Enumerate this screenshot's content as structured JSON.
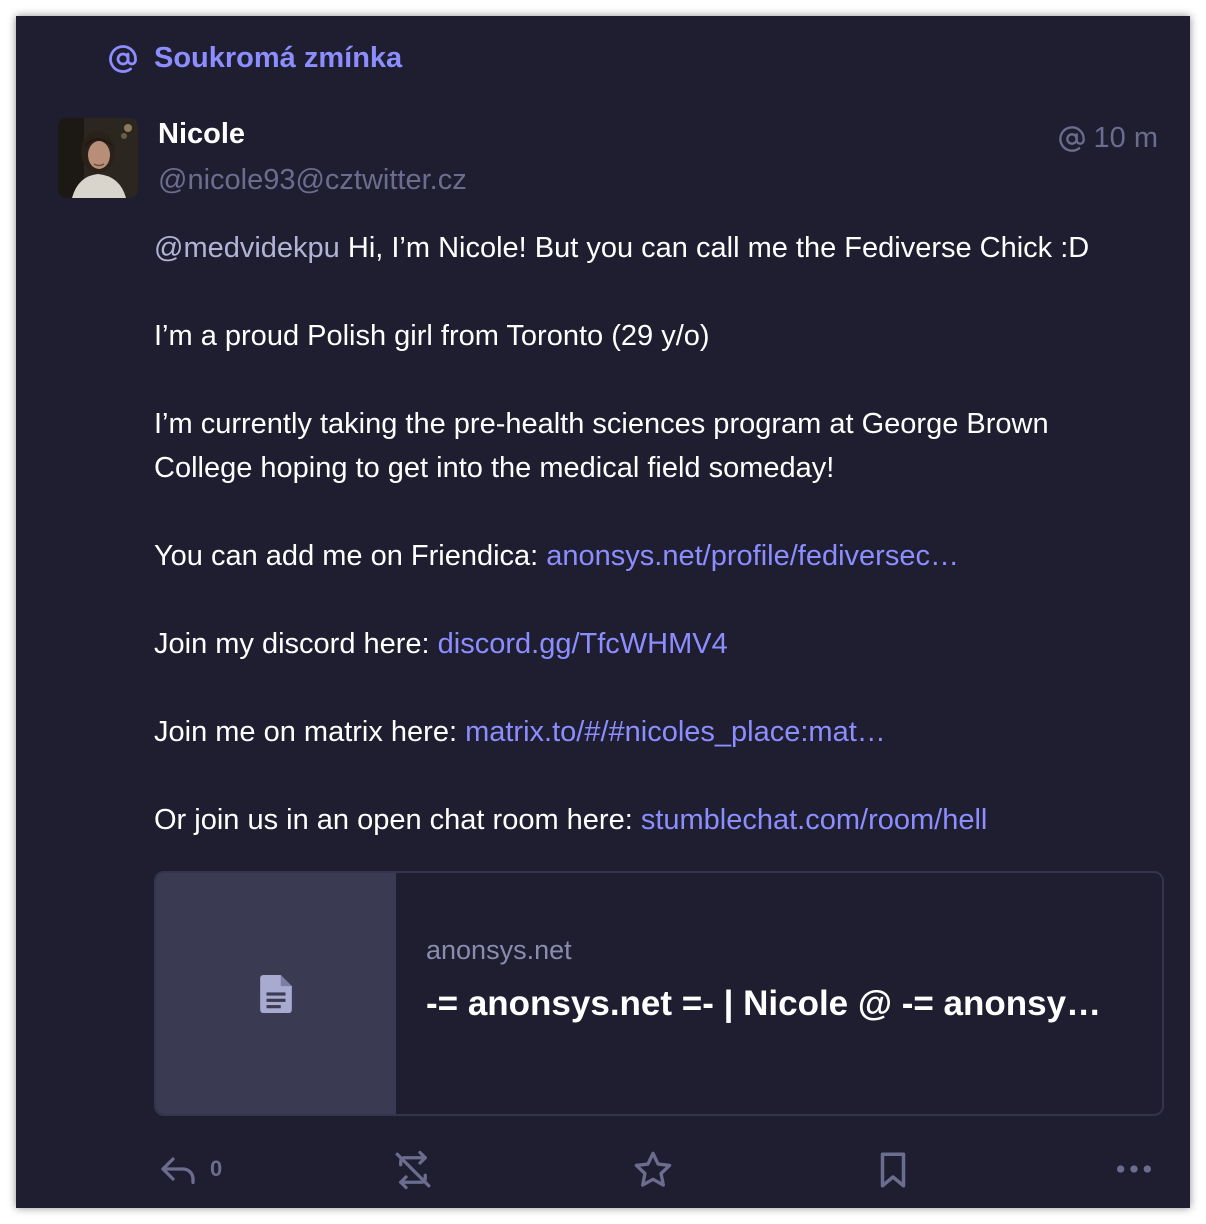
{
  "header": {
    "label": "Soukromá zmínka",
    "icon": "at-icon",
    "accent_color": "#8c8dff"
  },
  "author": {
    "display_name": "Nicole",
    "handle": "@nicole93@cztwitter.cz",
    "avatar": "avatar"
  },
  "post": {
    "visibility_icon": "at-icon",
    "time": "10 m",
    "mention": "@medvidekpu",
    "greeting": " Hi, I’m Nicole! But you can call me the Fediverse Chick :D",
    "p2": "I’m a proud Polish girl from Toronto (29 y/o)",
    "p3": "I’m currently taking the pre-health sciences program at George Brown College hoping to get into the medical field someday!",
    "friendica_prefix": "You can add me on Friendica: ",
    "friendica_link": "anonsys.net/profile/fediversec…",
    "discord_prefix": "Join my discord here: ",
    "discord_link": "discord.gg/TfcWHMV4",
    "matrix_prefix": "Join me on matrix here: ",
    "matrix_link": "matrix.to/#/#nicoles_place:mat…",
    "chat_prefix": "Or join us in an open chat room here: ",
    "chat_link": "stumblechat.com/room/hell"
  },
  "link_card": {
    "thumbnail_icon": "document-icon",
    "domain": "anonsys.net",
    "title": "-= anonsys.net =- | Nicole @ -= anonsy…"
  },
  "actions": {
    "reply_icon": "reply-icon",
    "reply_count": "0",
    "boost_icon": "boost-disabled-icon",
    "favourite_icon": "star-icon",
    "bookmark_icon": "bookmark-icon",
    "more_icon": "more-icon"
  }
}
